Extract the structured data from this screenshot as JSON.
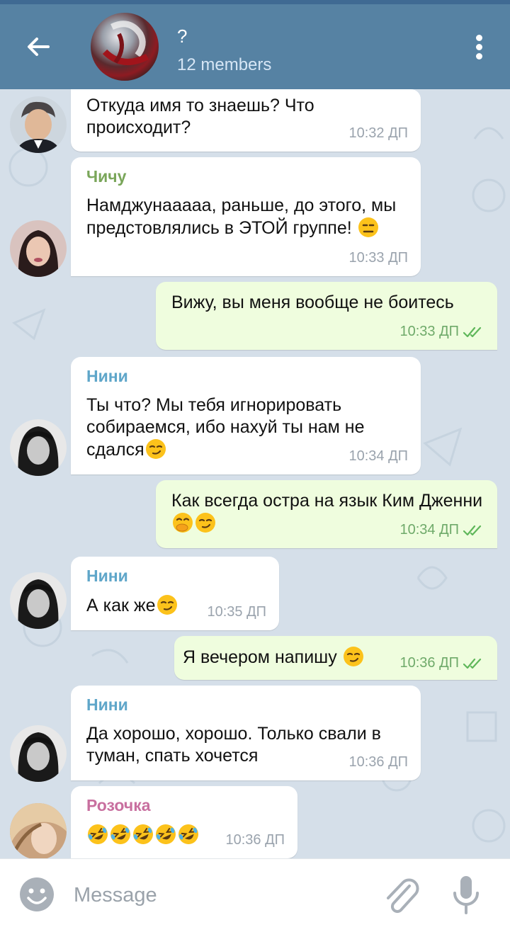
{
  "header": {
    "title": "?",
    "members": "12 members"
  },
  "messages": [
    {
      "direction": "in",
      "sender": "",
      "text": "Откуда имя то знаешь? Что происходит?",
      "time": "10:32 ДП",
      "avatar": "avatar-namjoon"
    },
    {
      "direction": "in",
      "sender": "Чичу",
      "text": "Намджунааааа, раньше, до этого, мы предстовлялись в ЭТОЙ группе!",
      "emoji": [
        "expressionless"
      ],
      "time": "10:33 ДП",
      "avatar": "avatar-chichu"
    },
    {
      "direction": "out",
      "text": "Вижу, вы меня вообще не боитесь",
      "time": "10:33 ДП"
    },
    {
      "direction": "in",
      "sender": "Нини",
      "text": "Ты что? Мы тебя игнорировать собираемся, ибо нахуй ты нам не сдался",
      "emoji": [
        "smirk"
      ],
      "time": "10:34 ДП",
      "avatar": "avatar-nini"
    },
    {
      "direction": "out",
      "text": "Как всегда остра на язык Ким Дженни",
      "emoji": [
        "hand-over-mouth",
        "smirk"
      ],
      "time": "10:34 ДП"
    },
    {
      "direction": "in",
      "sender": "Нини",
      "text": "А как же",
      "emoji": [
        "smirk"
      ],
      "time": "10:35 ДП",
      "avatar": "avatar-nini"
    },
    {
      "direction": "out",
      "text": "Я вечером напишу",
      "emoji": [
        "smirk"
      ],
      "time": "10:36 ДП"
    },
    {
      "direction": "in",
      "sender": "Нини",
      "text": "Да хорошо, хорошо. Только свали в туман, спать хочется",
      "time": "10:36 ДП",
      "avatar": "avatar-nini"
    },
    {
      "direction": "in",
      "sender": "Розочка",
      "text": "",
      "emoji": [
        "rofl",
        "rofl",
        "rofl",
        "rofl",
        "rofl"
      ],
      "time": "10:36 ДП",
      "avatar": "avatar-rosochka"
    }
  ],
  "sender_colors": {
    "Чичу": "#7aa65a",
    "Нини": "#5fa6c9",
    "Розочка": "#c86f9f"
  },
  "input": {
    "placeholder": "Message"
  },
  "icons": {
    "back": "arrow-left-icon",
    "menu": "more-vertical-icon",
    "emoji": "smile-icon",
    "attach": "paperclip-icon",
    "mic": "microphone-icon",
    "read": "double-check-icon"
  },
  "colors": {
    "header": "#5682a3",
    "incoming_bubble": "#ffffff",
    "outgoing_bubble": "#effdde",
    "chat_background": "#d5dfe9"
  }
}
